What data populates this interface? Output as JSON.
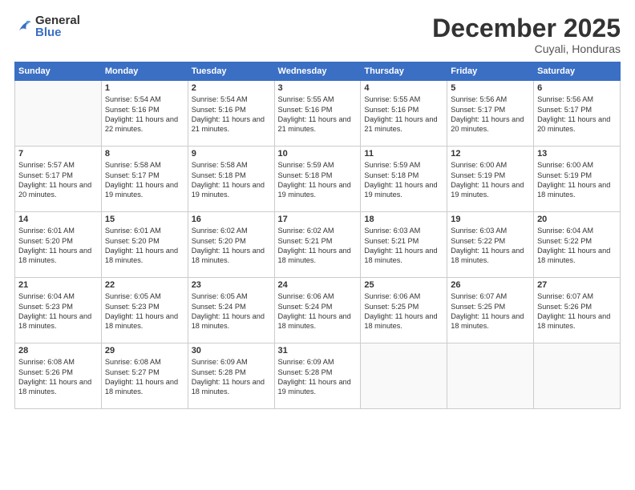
{
  "logo": {
    "general": "General",
    "blue": "Blue"
  },
  "title": "December 2025",
  "subtitle": "Cuyali, Honduras",
  "days": [
    "Sunday",
    "Monday",
    "Tuesday",
    "Wednesday",
    "Thursday",
    "Friday",
    "Saturday"
  ],
  "weeks": [
    [
      {
        "num": "",
        "info": ""
      },
      {
        "num": "1",
        "info": "Sunrise: 5:54 AM\nSunset: 5:16 PM\nDaylight: 11 hours and 22 minutes."
      },
      {
        "num": "2",
        "info": "Sunrise: 5:54 AM\nSunset: 5:16 PM\nDaylight: 11 hours and 21 minutes."
      },
      {
        "num": "3",
        "info": "Sunrise: 5:55 AM\nSunset: 5:16 PM\nDaylight: 11 hours and 21 minutes."
      },
      {
        "num": "4",
        "info": "Sunrise: 5:55 AM\nSunset: 5:16 PM\nDaylight: 11 hours and 21 minutes."
      },
      {
        "num": "5",
        "info": "Sunrise: 5:56 AM\nSunset: 5:17 PM\nDaylight: 11 hours and 20 minutes."
      },
      {
        "num": "6",
        "info": "Sunrise: 5:56 AM\nSunset: 5:17 PM\nDaylight: 11 hours and 20 minutes."
      }
    ],
    [
      {
        "num": "7",
        "info": "Sunrise: 5:57 AM\nSunset: 5:17 PM\nDaylight: 11 hours and 20 minutes."
      },
      {
        "num": "8",
        "info": "Sunrise: 5:58 AM\nSunset: 5:17 PM\nDaylight: 11 hours and 19 minutes."
      },
      {
        "num": "9",
        "info": "Sunrise: 5:58 AM\nSunset: 5:18 PM\nDaylight: 11 hours and 19 minutes."
      },
      {
        "num": "10",
        "info": "Sunrise: 5:59 AM\nSunset: 5:18 PM\nDaylight: 11 hours and 19 minutes."
      },
      {
        "num": "11",
        "info": "Sunrise: 5:59 AM\nSunset: 5:18 PM\nDaylight: 11 hours and 19 minutes."
      },
      {
        "num": "12",
        "info": "Sunrise: 6:00 AM\nSunset: 5:19 PM\nDaylight: 11 hours and 19 minutes."
      },
      {
        "num": "13",
        "info": "Sunrise: 6:00 AM\nSunset: 5:19 PM\nDaylight: 11 hours and 18 minutes."
      }
    ],
    [
      {
        "num": "14",
        "info": "Sunrise: 6:01 AM\nSunset: 5:20 PM\nDaylight: 11 hours and 18 minutes."
      },
      {
        "num": "15",
        "info": "Sunrise: 6:01 AM\nSunset: 5:20 PM\nDaylight: 11 hours and 18 minutes."
      },
      {
        "num": "16",
        "info": "Sunrise: 6:02 AM\nSunset: 5:20 PM\nDaylight: 11 hours and 18 minutes."
      },
      {
        "num": "17",
        "info": "Sunrise: 6:02 AM\nSunset: 5:21 PM\nDaylight: 11 hours and 18 minutes."
      },
      {
        "num": "18",
        "info": "Sunrise: 6:03 AM\nSunset: 5:21 PM\nDaylight: 11 hours and 18 minutes."
      },
      {
        "num": "19",
        "info": "Sunrise: 6:03 AM\nSunset: 5:22 PM\nDaylight: 11 hours and 18 minutes."
      },
      {
        "num": "20",
        "info": "Sunrise: 6:04 AM\nSunset: 5:22 PM\nDaylight: 11 hours and 18 minutes."
      }
    ],
    [
      {
        "num": "21",
        "info": "Sunrise: 6:04 AM\nSunset: 5:23 PM\nDaylight: 11 hours and 18 minutes."
      },
      {
        "num": "22",
        "info": "Sunrise: 6:05 AM\nSunset: 5:23 PM\nDaylight: 11 hours and 18 minutes."
      },
      {
        "num": "23",
        "info": "Sunrise: 6:05 AM\nSunset: 5:24 PM\nDaylight: 11 hours and 18 minutes."
      },
      {
        "num": "24",
        "info": "Sunrise: 6:06 AM\nSunset: 5:24 PM\nDaylight: 11 hours and 18 minutes."
      },
      {
        "num": "25",
        "info": "Sunrise: 6:06 AM\nSunset: 5:25 PM\nDaylight: 11 hours and 18 minutes."
      },
      {
        "num": "26",
        "info": "Sunrise: 6:07 AM\nSunset: 5:25 PM\nDaylight: 11 hours and 18 minutes."
      },
      {
        "num": "27",
        "info": "Sunrise: 6:07 AM\nSunset: 5:26 PM\nDaylight: 11 hours and 18 minutes."
      }
    ],
    [
      {
        "num": "28",
        "info": "Sunrise: 6:08 AM\nSunset: 5:26 PM\nDaylight: 11 hours and 18 minutes."
      },
      {
        "num": "29",
        "info": "Sunrise: 6:08 AM\nSunset: 5:27 PM\nDaylight: 11 hours and 18 minutes."
      },
      {
        "num": "30",
        "info": "Sunrise: 6:09 AM\nSunset: 5:28 PM\nDaylight: 11 hours and 18 minutes."
      },
      {
        "num": "31",
        "info": "Sunrise: 6:09 AM\nSunset: 5:28 PM\nDaylight: 11 hours and 19 minutes."
      },
      {
        "num": "",
        "info": ""
      },
      {
        "num": "",
        "info": ""
      },
      {
        "num": "",
        "info": ""
      }
    ]
  ]
}
